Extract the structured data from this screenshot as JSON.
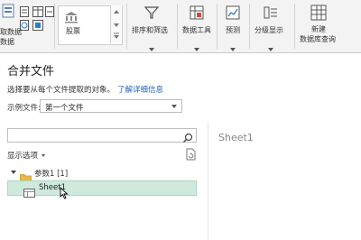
{
  "ribbon": {
    "get_data_label_1": "取数据",
    "get_data_label_2": "数据",
    "stock_label": "股票",
    "sort_filter_label": "排序和筛选",
    "data_tools_label": "数据工具",
    "forecast_label": "预测",
    "outline_label": "分级显示",
    "new_query_label_1": "新建",
    "new_query_label_2": "数据库查询"
  },
  "dialog": {
    "title": "合并文件",
    "description": "选择要从每个文件提取的对象。",
    "learn_more_link": "了解详细信息",
    "sample_file_label": "示例文件:",
    "sample_file_value": "第一个文件",
    "search_placeholder": "",
    "display_options_label": "显示选项",
    "folder_label": "参数1 [1]",
    "sheet_item_label": "Sheet1",
    "preview_title": "Sheet1"
  },
  "colors": {
    "selection_background": "#cfeadd",
    "link": "#1f5fb8",
    "folder": "#e6b94a"
  },
  "icons": [
    "get-data-icon",
    "text-csv-icon",
    "web-icon",
    "table-range-icon",
    "stock-bank-icon",
    "filter-icon",
    "data-tools-icon",
    "forecast-icon",
    "outline-icon",
    "new-database-query-icon",
    "search-icon",
    "refresh-icon",
    "folder-icon",
    "sheet-icon",
    "mouse-cursor-icon"
  ]
}
